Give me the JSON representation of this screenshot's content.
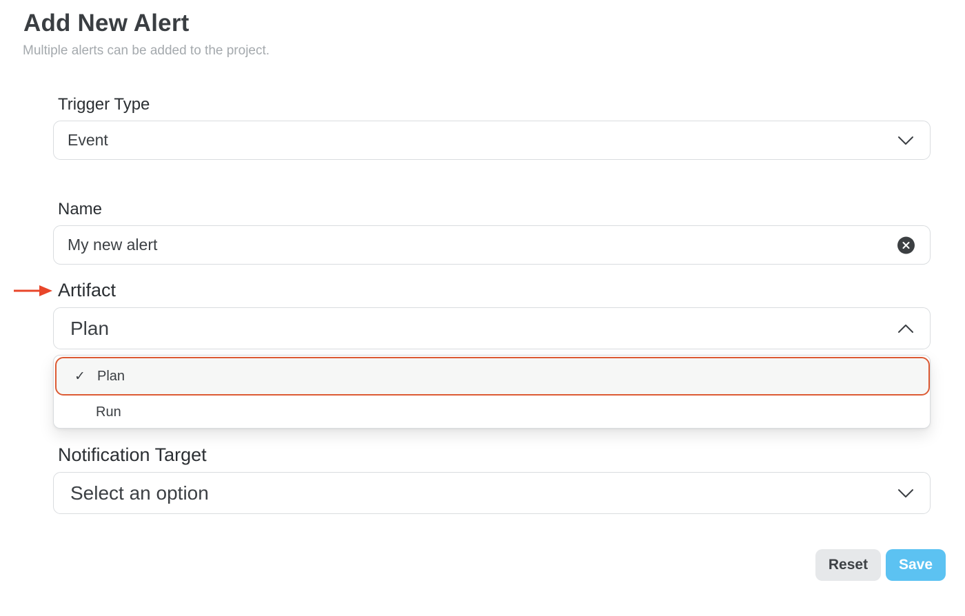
{
  "header": {
    "title": "Add New Alert",
    "subtitle": "Multiple alerts can be added to the project."
  },
  "form": {
    "trigger_type": {
      "label": "Trigger Type",
      "value": "Event",
      "icon": "chevron-down-icon"
    },
    "name": {
      "label": "Name",
      "value": "My new alert",
      "icon": "clear-icon"
    },
    "artifact": {
      "label": "Artifact",
      "value": "Plan",
      "icon": "chevron-up-icon",
      "expanded": true,
      "options": [
        {
          "label": "Plan",
          "selected": true,
          "check": "✓"
        },
        {
          "label": "Run",
          "selected": false
        }
      ]
    },
    "notification_target": {
      "label": "Notification Target",
      "placeholder": "Select an option",
      "icon": "chevron-down-icon"
    }
  },
  "actions": {
    "reset_label": "Reset",
    "save_label": "Save"
  },
  "colors": {
    "highlight_border": "#dc5a33",
    "arrow": "#e8462a",
    "save_button": "#5cc2f2",
    "reset_button": "#e6e8ea"
  }
}
